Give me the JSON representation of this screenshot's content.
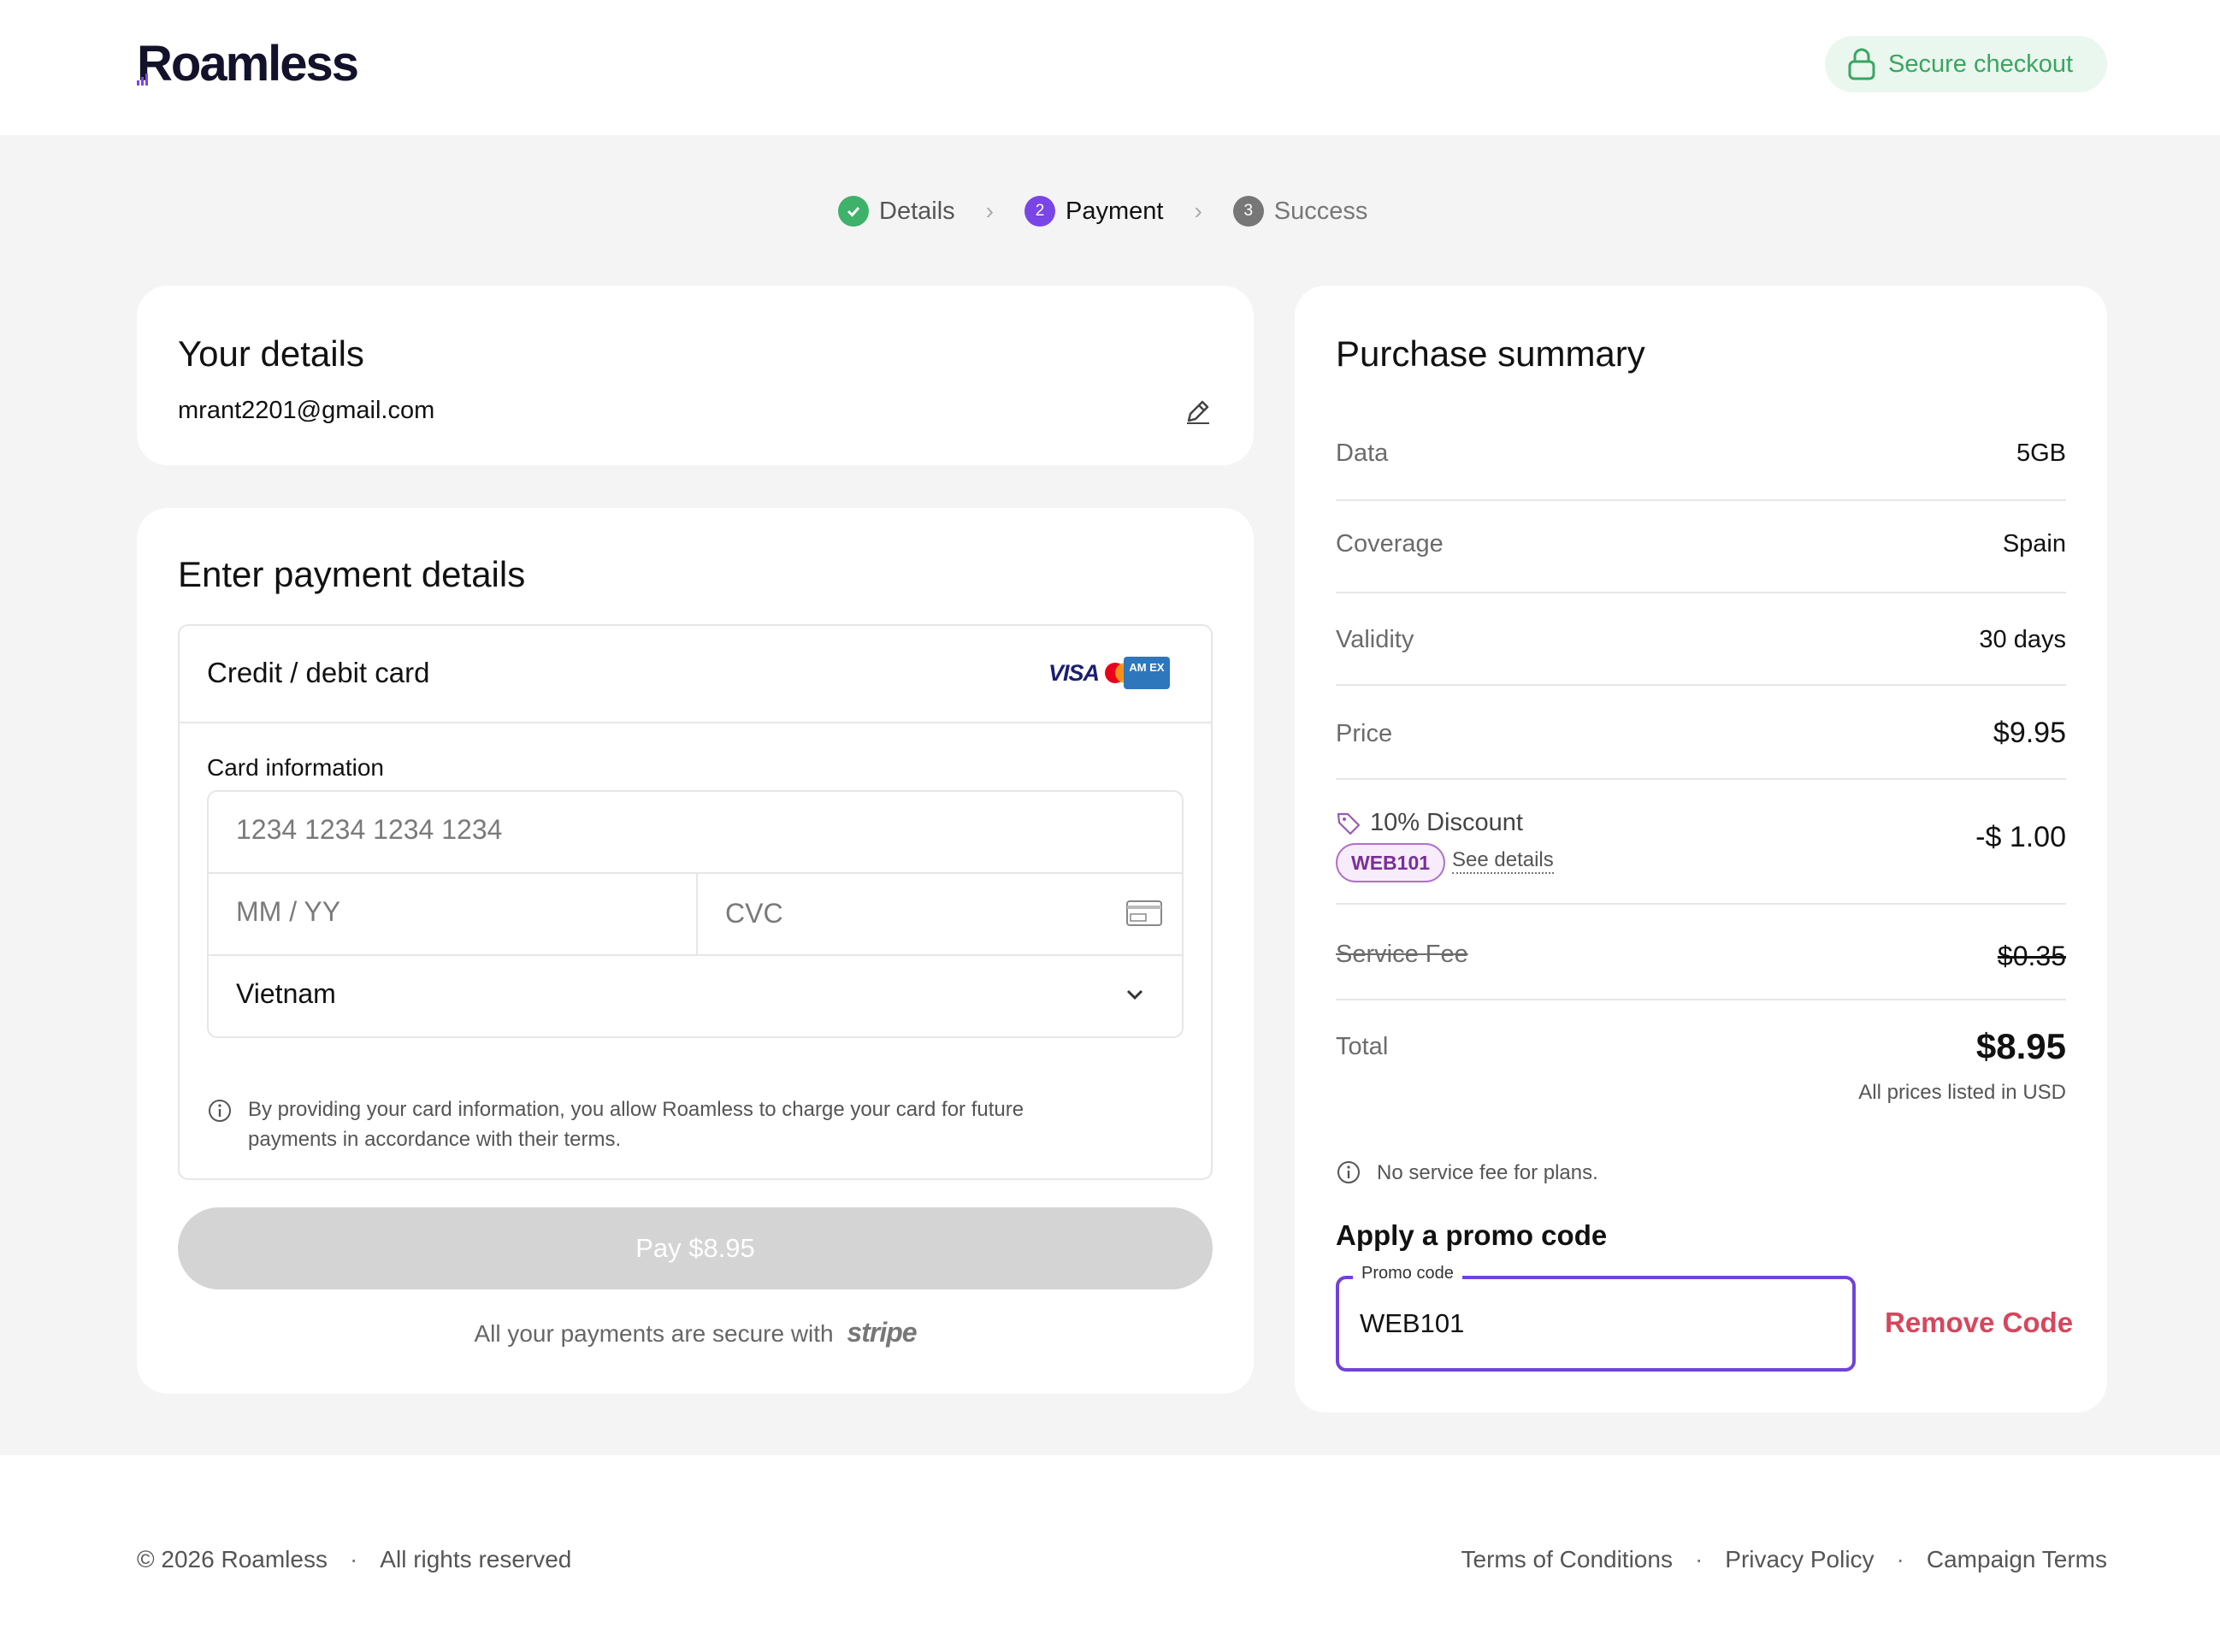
{
  "header": {
    "logo_text": "Roamless",
    "secure_label": "Secure checkout"
  },
  "stepper": [
    {
      "number": "",
      "label": "Details",
      "state": "done"
    },
    {
      "number": "2",
      "label": "Payment",
      "state": "active"
    },
    {
      "number": "3",
      "label": "Success",
      "state": "todo"
    }
  ],
  "details": {
    "title": "Your details",
    "email": "mrant2201@gmail.com"
  },
  "payment": {
    "title": "Enter payment details",
    "method_label": "Credit / debit card",
    "card_brands": {
      "visa": "VISA",
      "amex": "AM EX"
    },
    "card_info_label": "Card information",
    "card_number_placeholder": "1234 1234 1234 1234",
    "expiry_placeholder": "MM / YY",
    "cvc_placeholder": "CVC",
    "country_value": "Vietnam",
    "notice": "By providing your card information, you allow Roamless to charge your card for future payments in accordance with their terms.",
    "pay_button": "Pay $8.95",
    "secure_line": "All your payments are secure with",
    "stripe_word": "stripe"
  },
  "summary": {
    "title": "Purchase summary",
    "rows": [
      {
        "label": "Data",
        "value": "5GB"
      },
      {
        "label": "Coverage",
        "value": "Spain"
      },
      {
        "label": "Validity",
        "value": "30 days"
      },
      {
        "label": "Price",
        "value": "$9.95"
      }
    ],
    "discount": {
      "label": "10% Discount",
      "code_badge": "WEB101",
      "see_details": "See details",
      "value": "-$ 1.00"
    },
    "service_fee": {
      "label": "Service Fee",
      "value": "$0.35"
    },
    "total": {
      "label": "Total",
      "value": "$8.95",
      "note": "All prices listed in USD"
    },
    "no_fee_note": "No service fee for plans.",
    "promo": {
      "title": "Apply a promo code",
      "field_label": "Promo code",
      "field_value": "WEB101",
      "remove_label": "Remove Code"
    }
  },
  "footer": {
    "copyright": "© 2026 Roamless",
    "rights": "All rights reserved",
    "links": [
      "Terms of Conditions",
      "Privacy Policy",
      "Campaign Terms"
    ]
  },
  "colors": {
    "accent_purple": "#7a45e6",
    "success_green": "#3eb16a",
    "remove_red": "#d8465c",
    "page_bg": "#f4f4f5"
  }
}
